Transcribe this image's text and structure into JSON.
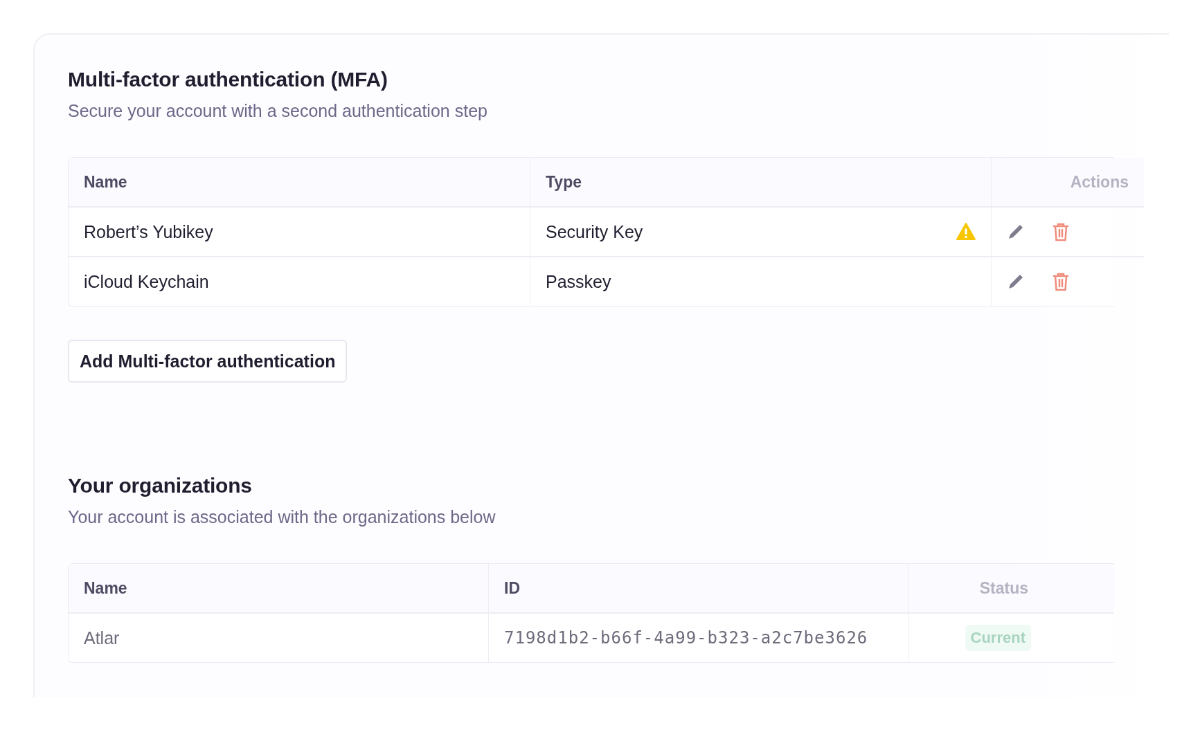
{
  "mfa": {
    "title": "Multi-factor authentication (MFA)",
    "subtitle": "Secure your account with a second authentication step",
    "columns": [
      "Name",
      "Type",
      "Actions"
    ],
    "rows": [
      {
        "name": "Robert’s Yubikey",
        "type": "Security Key",
        "warning": true
      },
      {
        "name": "iCloud Keychain",
        "type": "Passkey",
        "warning": false
      }
    ],
    "add_button": "Add Multi-factor authentication"
  },
  "organizations": {
    "title": "Your organizations",
    "subtitle": "Your account is associated with the organizations below",
    "columns": [
      "Name",
      "ID",
      "Status"
    ],
    "rows": [
      {
        "name": "Atlar",
        "id": "7198d1b2-b66f-4a99-b323-a2c7be3626",
        "status": "Current"
      }
    ]
  }
}
